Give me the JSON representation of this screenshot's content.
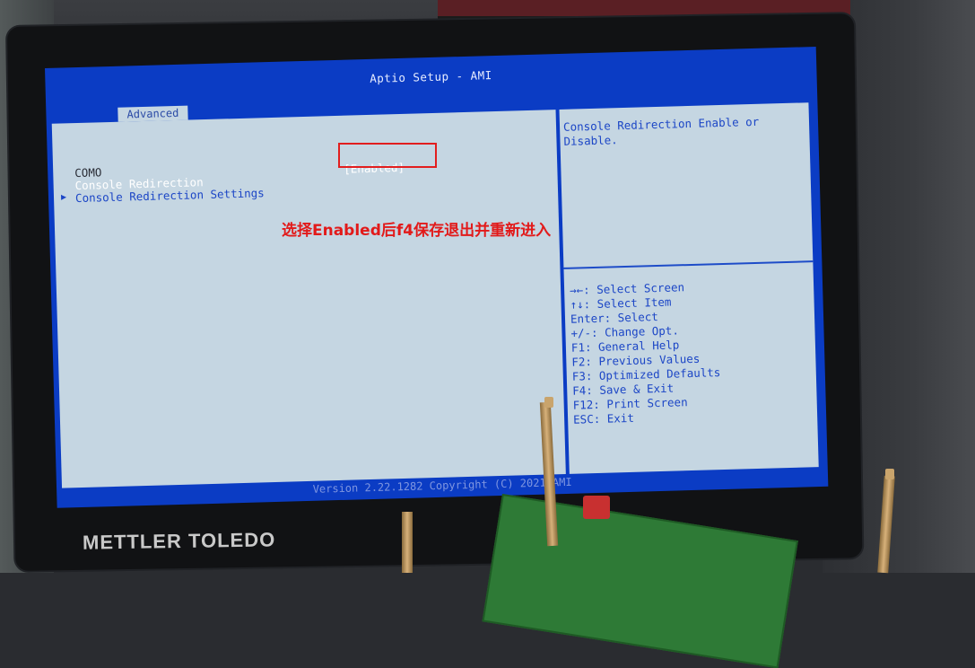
{
  "bios": {
    "title": "Aptio Setup - AMI",
    "active_tab": "Advanced",
    "items": [
      {
        "label": "COMO",
        "value": "",
        "state": "normal"
      },
      {
        "label": "Console Redirection",
        "value": "[Enabled]",
        "state": "selected"
      },
      {
        "label": "Console Redirection Settings",
        "value": "",
        "state": "submenu",
        "marker": "▶"
      }
    ],
    "help": {
      "description_lines": [
        "Console Redirection Enable or",
        "Disable."
      ],
      "keys": [
        "→←: Select Screen",
        "↑↓: Select Item",
        "Enter: Select",
        "+/-: Change Opt.",
        "F1: General Help",
        "F2: Previous Values",
        "F3: Optimized Defaults",
        "F4: Save & Exit",
        "F12: Print Screen",
        "ESC: Exit"
      ]
    },
    "footer": "Version 2.22.1282 Copyright (C) 2021 AMI"
  },
  "annotation": {
    "text": "选择Enabled后f4保存退出并重新进入",
    "color": "#e21a1a"
  },
  "monitor_brand": "METTLER TOLEDO",
  "colors": {
    "bios_blue": "#0b3cc4",
    "bios_panel": "#c5d6e2",
    "bios_accent_text": "#1c46c6",
    "highlight_red": "#e21e1e"
  }
}
